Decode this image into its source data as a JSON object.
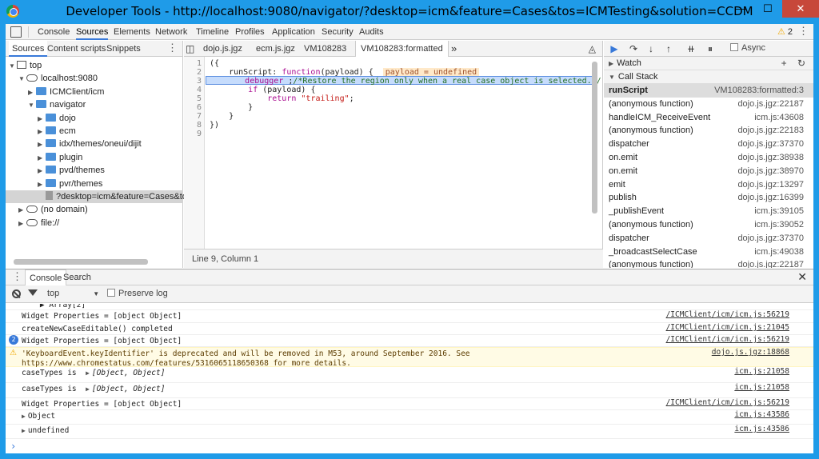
{
  "window": {
    "title": "Developer Tools - http://localhost:9080/navigator/?desktop=icm&feature=Cases&tos=ICMTesting&solution=CCDM",
    "minimize": "—",
    "maximize": "☐",
    "close": "✕"
  },
  "devtools_tabs": [
    "Console",
    "Sources",
    "Elements",
    "Network",
    "Timeline",
    "Profiles",
    "Application",
    "Security",
    "Audits"
  ],
  "warning_count": "2",
  "navigator": {
    "tabs": [
      "Sources",
      "Content scripts",
      "Snippets"
    ],
    "tree": [
      {
        "label": "top",
        "kind": "frame",
        "arrow": "▼",
        "depth": 0
      },
      {
        "label": "localhost:9080",
        "kind": "cloud",
        "arrow": "▼",
        "depth": 1
      },
      {
        "label": "ICMClient/icm",
        "kind": "folder",
        "arrow": "▶",
        "depth": 2
      },
      {
        "label": "navigator",
        "kind": "folder",
        "arrow": "▼",
        "depth": 2
      },
      {
        "label": "dojo",
        "kind": "folder",
        "arrow": "▶",
        "depth": 3
      },
      {
        "label": "ecm",
        "kind": "folder",
        "arrow": "▶",
        "depth": 3
      },
      {
        "label": "idx/themes/oneui/dijit",
        "kind": "folder",
        "arrow": "▶",
        "depth": 3
      },
      {
        "label": "plugin",
        "kind": "folder",
        "arrow": "▶",
        "depth": 3
      },
      {
        "label": "pvd/themes",
        "kind": "folder",
        "arrow": "▶",
        "depth": 3
      },
      {
        "label": "pvr/themes",
        "kind": "folder",
        "arrow": "▶",
        "depth": 3
      },
      {
        "label": "?desktop=icm&feature=Cases&tos=I",
        "kind": "file",
        "arrow": "",
        "depth": 3,
        "selected": true
      },
      {
        "label": "(no domain)",
        "kind": "cloud",
        "arrow": "▶",
        "depth": 1
      },
      {
        "label": "file://",
        "kind": "cloud",
        "arrow": "▶",
        "depth": 1
      }
    ]
  },
  "editor": {
    "tabs": [
      "dojo.js.jgz",
      "ecm.js.jgz",
      "VM108283",
      "VM108283:formatted"
    ],
    "more_tabs": "»",
    "line_numbers": [
      "1",
      "2",
      "3",
      "4",
      "5",
      "6",
      "7",
      "8",
      "9"
    ],
    "lines": {
      "l1": "({",
      "l2a": "    runScript: ",
      "l2b": "function",
      "l2c": "(payload) {  ",
      "l2d": "payload = undefined",
      "l3a": "        ",
      "l3b": "debugger",
      "l3c": " ;",
      "l3d": "/*Restore the region only when a real case object is selected.*/",
      "l4a": "        ",
      "l4b": "if",
      "l4c": " (payload) {",
      "l5a": "            ",
      "l5b": "return",
      "l5c": " ",
      "l5d": "\"trailing\"",
      "l5e": ";",
      "l6": "        }",
      "l7": "    }",
      "l8": "})",
      "l9": ""
    },
    "status": "Line 9, Column 1"
  },
  "debugger": {
    "async_label": "Async",
    "watch_label": "Watch",
    "watch_add": "+",
    "watch_refresh": "↻",
    "callstack_label": "Call Stack",
    "frames": [
      {
        "fn": "runScript",
        "loc": "VM108283:formatted:3"
      },
      {
        "fn": "(anonymous function)",
        "loc": "dojo.js.jgz:22187"
      },
      {
        "fn": "handleICM_ReceiveEvent",
        "loc": "icm.js:43608"
      },
      {
        "fn": "(anonymous function)",
        "loc": "dojo.js.jgz:22183"
      },
      {
        "fn": "dispatcher",
        "loc": "dojo.js.jgz:37370"
      },
      {
        "fn": "on.emit",
        "loc": "dojo.js.jgz:38938"
      },
      {
        "fn": "on.emit",
        "loc": "dojo.js.jgz:38970"
      },
      {
        "fn": "emit",
        "loc": "dojo.js.jgz:13297"
      },
      {
        "fn": "publish",
        "loc": "dojo.js.jgz:16399"
      },
      {
        "fn": "_publishEvent",
        "loc": "icm.js:39105"
      },
      {
        "fn": "(anonymous function)",
        "loc": "icm.js:39052"
      },
      {
        "fn": "dispatcher",
        "loc": "dojo.js.jgz:37370"
      },
      {
        "fn": "_broadcastSelectCase",
        "loc": "icm.js:49038"
      },
      {
        "fn": "(anonymous function)",
        "loc": "dojo.js.jgz:22187"
      }
    ]
  },
  "drawer": {
    "tabs": [
      "Console",
      "Search"
    ],
    "context": "top",
    "preserve_log": "Preserve log",
    "messages": [
      {
        "text": "    ▶ Array[2]",
        "src": "",
        "kind": "partial"
      },
      {
        "text": "Widget Properties = [object Object]",
        "src": "/ICMClient/icm/icm.js:56219",
        "kind": "log"
      },
      {
        "text": "createNewCaseEditable() completed",
        "src": "/ICMClient/icm/icm.js:21045",
        "kind": "log"
      },
      {
        "text": "Widget Properties = [object Object]",
        "src": "/ICMClient/icm/icm.js:56219",
        "kind": "count",
        "count": "2"
      },
      {
        "text": "'KeyboardEvent.keyIdentifier' is deprecated and will be removed in M53, around September 2016. See https://www.chromestatus.com/features/5316065118650368 for more details.",
        "src": "dojo.js.jgz:18868",
        "kind": "warn"
      },
      {
        "text": "caseTypes is  ",
        "obj": "[Object, Object]",
        "src": "icm.js:21058",
        "kind": "obj"
      },
      {
        "text": "caseTypes is  ",
        "obj": "[Object, Object]",
        "src": "icm.js:21058",
        "kind": "obj"
      },
      {
        "text": "Widget Properties = [object Object]",
        "src": "/ICMClient/icm/icm.js:56219",
        "kind": "log"
      },
      {
        "text": "Object",
        "src": "icm.js:43586",
        "kind": "expand"
      },
      {
        "text": "undefined",
        "src": "icm.js:43586",
        "kind": "expand"
      }
    ],
    "prompt": "›"
  }
}
